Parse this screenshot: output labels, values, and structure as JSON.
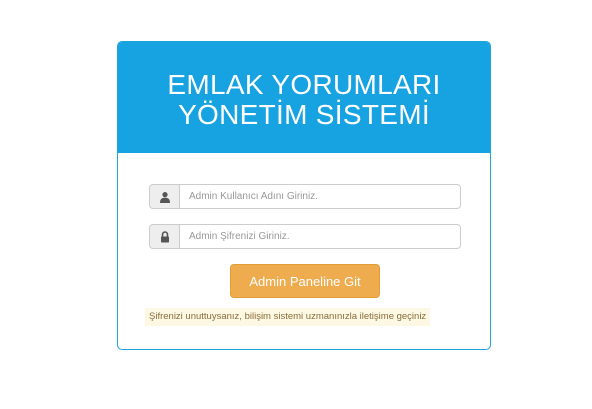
{
  "header": {
    "title_line1": "EMLAK YORUMLARI",
    "title_line2": "YÖNETİM SİSTEMİ"
  },
  "form": {
    "username": {
      "icon": "user-icon",
      "value": "",
      "placeholder": "Admin Kullanıcı Adını Giriniz."
    },
    "password": {
      "icon": "lock-icon",
      "value": "",
      "placeholder": "Admin Şifrenizi Giriniz."
    },
    "submit_label": "Admin Paneline Git"
  },
  "help": {
    "text": "Şifrenizi unuttuysanız, bilişim sistemi uzmanınızla iletişime geçiniz"
  },
  "colors": {
    "header_bg": "#17a2e1",
    "button_bg": "#efac4e",
    "help_bg": "#fcf8e3",
    "help_text": "#8a6d3b"
  }
}
